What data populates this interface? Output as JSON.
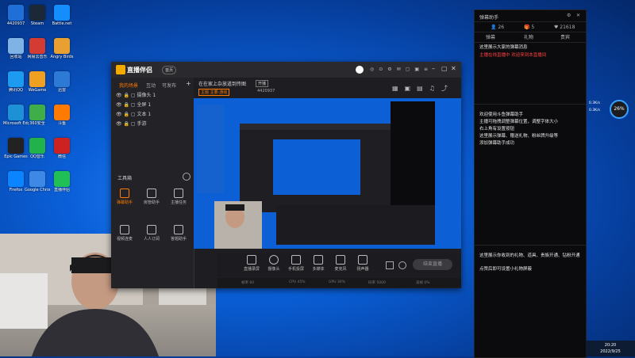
{
  "desktop": {
    "icons": [
      {
        "label": "4420937",
        "color": "#1f6fd6"
      },
      {
        "label": "Steam",
        "color": "#1b2838"
      },
      {
        "label": "Battle.net",
        "color": "#148eff"
      },
      {
        "label": "回收站",
        "color": "#7fb2e5"
      },
      {
        "label": "网易云音乐",
        "color": "#d43c33"
      },
      {
        "label": "Angry Birds",
        "color": "#e8a030"
      },
      {
        "label": "腾讯QQ",
        "color": "#1d9bf0"
      },
      {
        "label": "WeGame",
        "color": "#f0a020"
      },
      {
        "label": "迅雷",
        "color": "#2d7ad6"
      },
      {
        "label": "Microsoft Edge",
        "color": "#1e90d6"
      },
      {
        "label": "360安全",
        "color": "#3fae49"
      },
      {
        "label": "斗鱼",
        "color": "#ff7a00"
      },
      {
        "label": "Epic Games",
        "color": "#222222"
      },
      {
        "label": "QQ音乐",
        "color": "#22b24c"
      },
      {
        "label": "微信",
        "color": "#cc2222"
      },
      {
        "label": "Firefox",
        "color": "#0a84ff"
      },
      {
        "label": "Google Chrome",
        "color": "#3c8ae6"
      },
      {
        "label": "直播伴侣",
        "color": "#21c056"
      }
    ]
  },
  "app": {
    "logo": "直播伴侣",
    "badge": "首页",
    "tabs": [
      "我的场景",
      "互动",
      "可发布"
    ],
    "scenes": [
      "摄像头 1",
      "全屏 1",
      "文本 1",
      "手游"
    ],
    "tools_title": "工具箱",
    "tools": [
      "弹幕助手",
      "房管助手",
      "主播任务",
      "视频连麦",
      "人人订阅",
      "答题助手"
    ],
    "stream_title": "在在家上杂放道到传图",
    "live_tag": "开播",
    "category": "主题  主要-游戏",
    "uid": "4420937",
    "bottom_buttons": [
      "直播录屏",
      "摄像头",
      "手机投屏",
      "多媒体",
      "麦克风",
      "扬声器"
    ],
    "start_button": "结束直播",
    "status_items": [
      "帧率 60",
      "CPU 45%",
      "GPU 30%",
      "码率 5000",
      "丢帧 0%"
    ]
  },
  "danmu": {
    "title": "弹幕助手",
    "stats": [
      {
        "icon": "user-icon",
        "value": "26"
      },
      {
        "icon": "gift-icon",
        "value": "5"
      },
      {
        "icon": "heart-icon",
        "value": "21618"
      }
    ],
    "tabs": [
      "弹幕",
      "礼物",
      "贵宾"
    ],
    "messages": [
      {
        "text": "这里展示大家的弹幕消息",
        "color": "#e6e6e6"
      },
      {
        "text": "主播在线直播中 欢迎来到本直播间",
        "color": "#ff4040"
      },
      {
        "text": "欢迎使用斗鱼弹幕助手",
        "color": "#e6e6e6"
      },
      {
        "text": "主播可拖拽调整弹幕位置，调整字体大小",
        "color": "#e6e6e6"
      },
      {
        "text": "右上角有设置按钮",
        "color": "#e6e6e6"
      },
      {
        "text": "这里展示弹幕、赠送礼物、粉丝牌升级等",
        "color": "#e6e6e6"
      },
      {
        "text": "添加弹幕助手成功",
        "color": "#e6e6e6"
      },
      {
        "text": "这里展示你收到的礼物、道具、贵族开通、钻粉开通",
        "color": "#e6e6e6"
      },
      {
        "text": "点赞后即可设置小礼物屏蔽",
        "color": "#e6e6e6"
      }
    ]
  },
  "widget": {
    "percent": "26%",
    "line1": "0.3K/s",
    "line2": "0.3K/s"
  },
  "taskbar": {
    "time": "20:20",
    "date": "2022/9/25"
  }
}
